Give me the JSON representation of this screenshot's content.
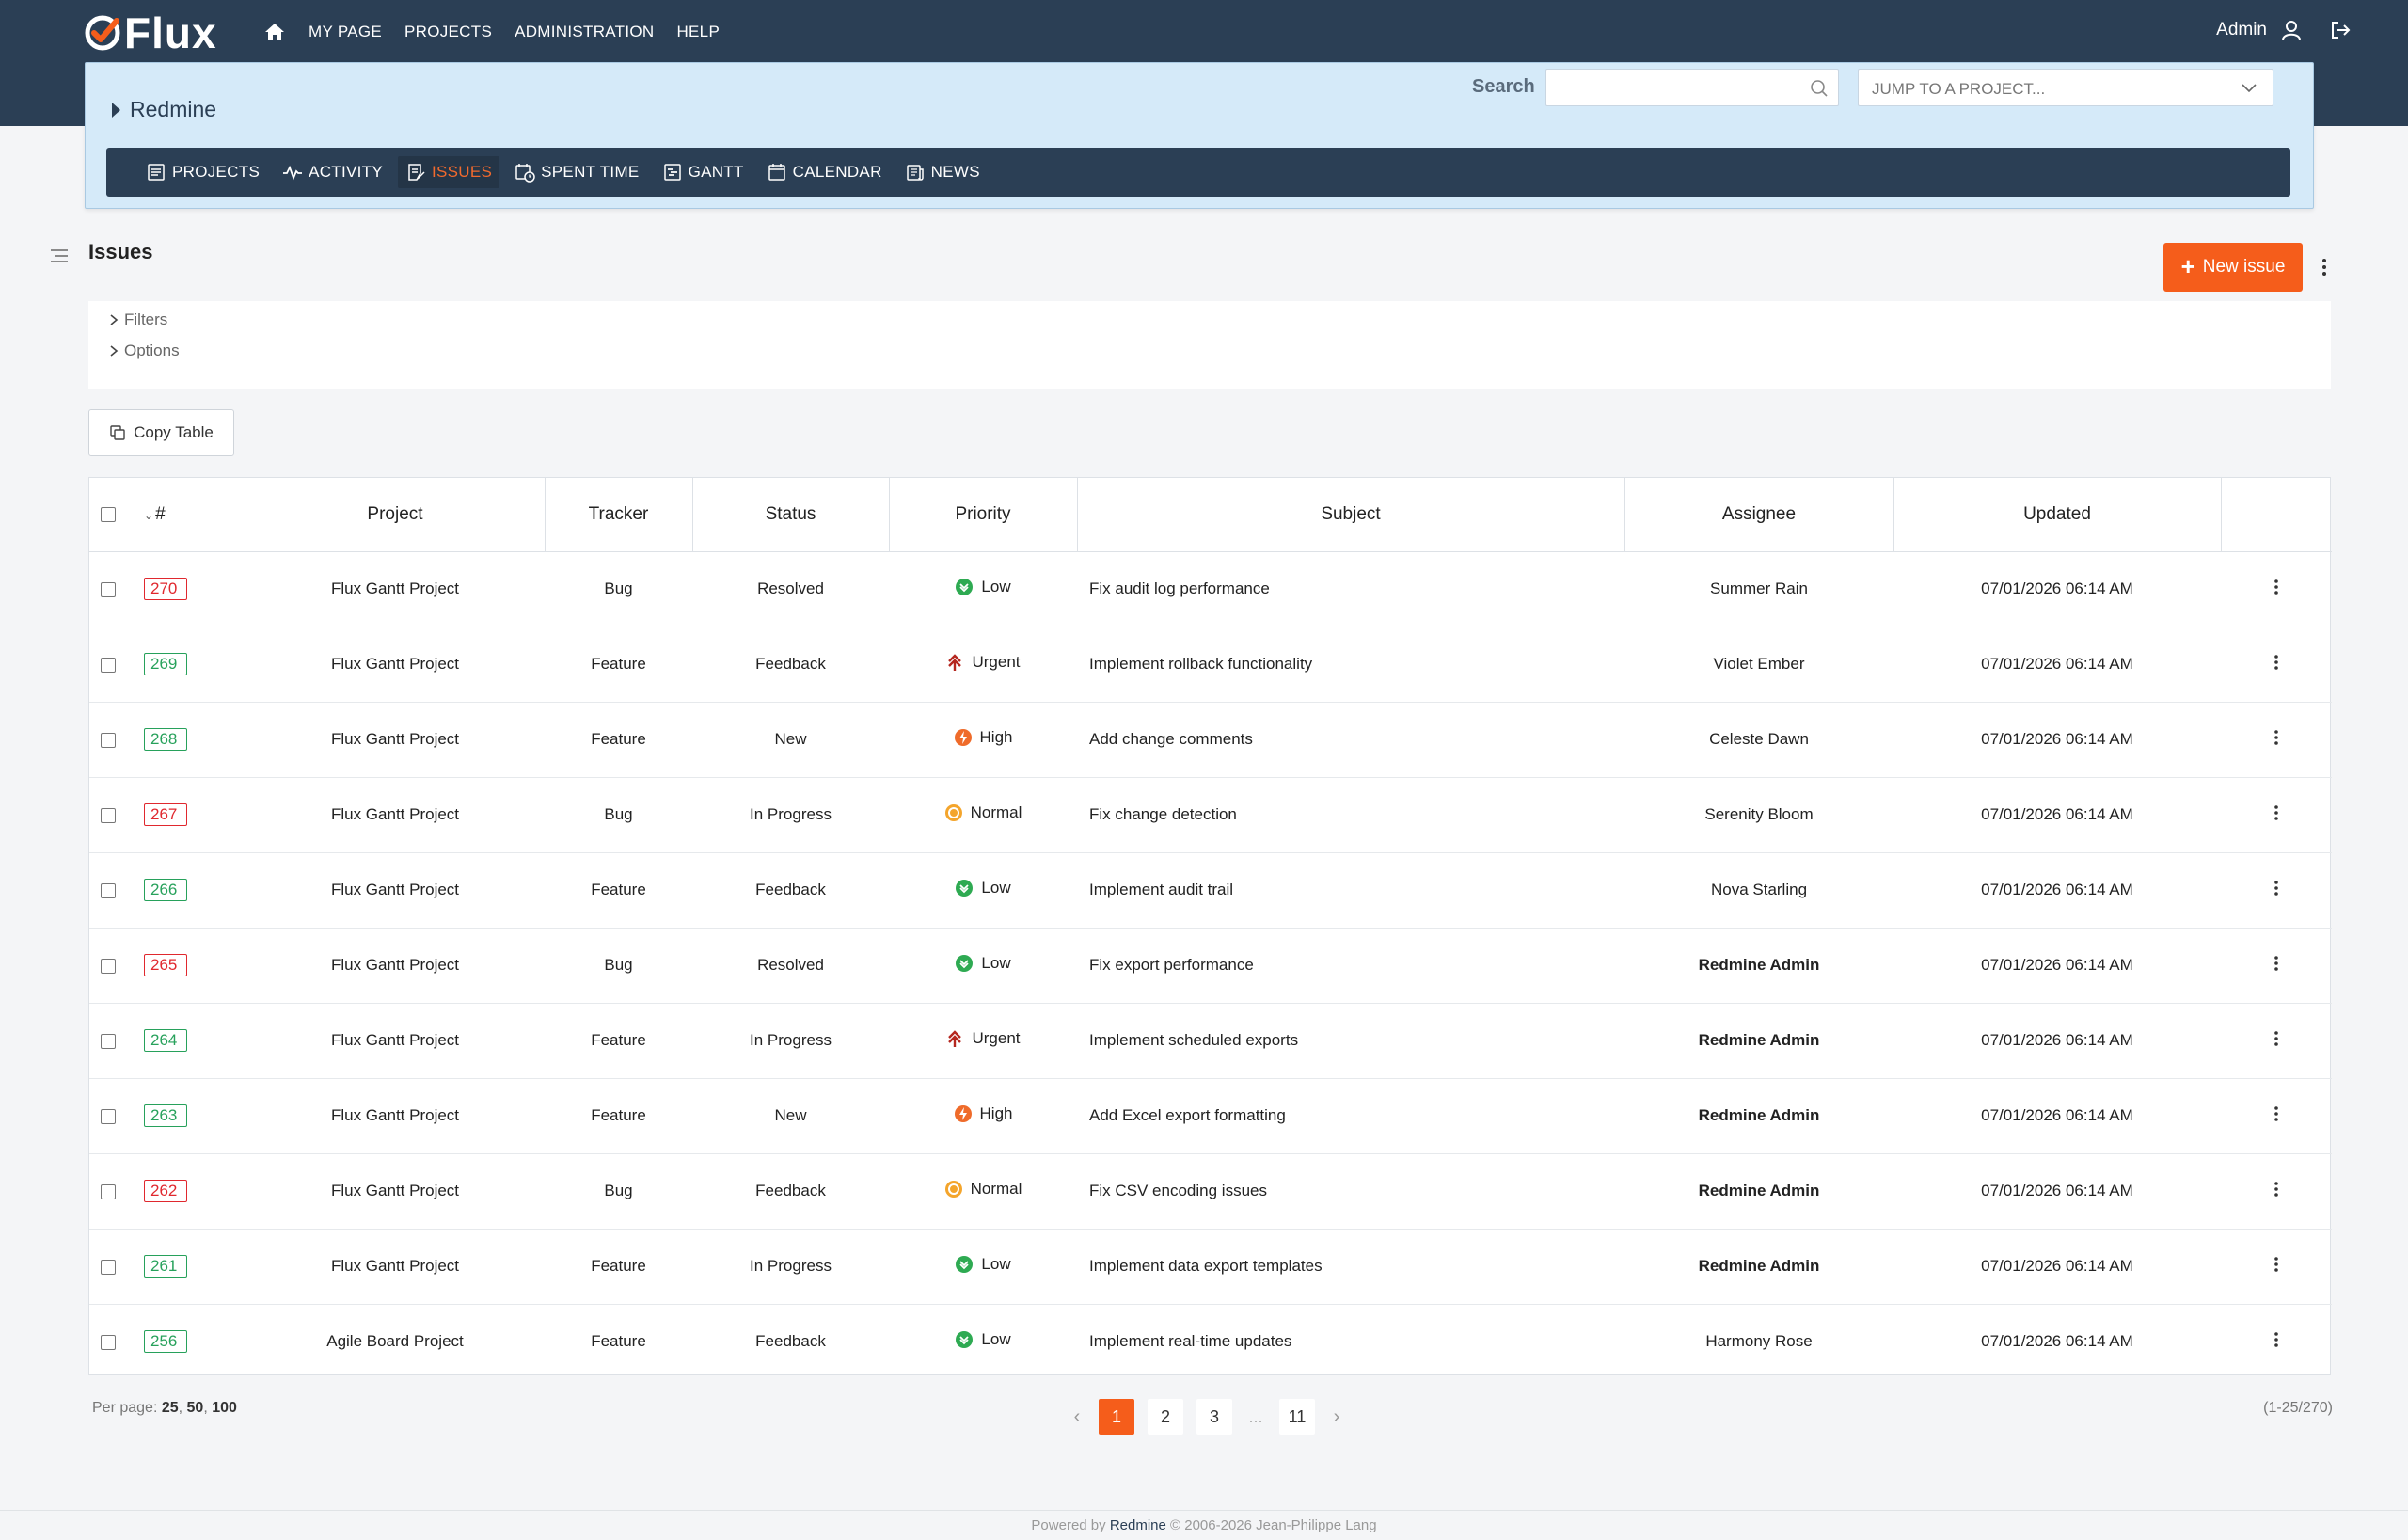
{
  "brand": {
    "name": "Flux"
  },
  "top_nav": {
    "items": [
      "MY PAGE",
      "PROJECTS",
      "ADMINISTRATION",
      "HELP"
    ]
  },
  "user": {
    "name": "Admin"
  },
  "project": {
    "name": "Redmine"
  },
  "search": {
    "label": "Search",
    "value": "",
    "jump_placeholder": "JUMP TO A PROJECT..."
  },
  "project_menu": {
    "items": [
      {
        "label": "PROJECTS",
        "icon": "projects-icon"
      },
      {
        "label": "ACTIVITY",
        "icon": "activity-icon"
      },
      {
        "label": "ISSUES",
        "icon": "issues-icon",
        "active": true
      },
      {
        "label": "SPENT TIME",
        "icon": "spent-time-icon"
      },
      {
        "label": "GANTT",
        "icon": "gantt-icon"
      },
      {
        "label": "CALENDAR",
        "icon": "calendar-icon"
      },
      {
        "label": "NEWS",
        "icon": "news-icon"
      }
    ]
  },
  "page": {
    "title": "Issues",
    "new_issue_label": "New issue"
  },
  "filters": {
    "filters_label": "Filters",
    "options_label": "Options"
  },
  "toolbar": {
    "copy_table_label": "Copy Table"
  },
  "table": {
    "columns": [
      "#",
      "Project",
      "Tracker",
      "Status",
      "Priority",
      "Subject",
      "Assignee",
      "Updated"
    ],
    "rows": [
      {
        "id": "270",
        "project": "Flux Gantt Project",
        "tracker": "Bug",
        "status": "Resolved",
        "priority": "Low",
        "subject": "Fix audit log performance",
        "assignee": "Summer Rain",
        "assignee_bold": false,
        "updated": "07/01/2026 06:14 AM"
      },
      {
        "id": "269",
        "project": "Flux Gantt Project",
        "tracker": "Feature",
        "status": "Feedback",
        "priority": "Urgent",
        "subject": "Implement rollback functionality",
        "assignee": "Violet Ember",
        "assignee_bold": false,
        "updated": "07/01/2026 06:14 AM"
      },
      {
        "id": "268",
        "project": "Flux Gantt Project",
        "tracker": "Feature",
        "status": "New",
        "priority": "High",
        "subject": "Add change comments",
        "assignee": "Celeste Dawn",
        "assignee_bold": false,
        "updated": "07/01/2026 06:14 AM"
      },
      {
        "id": "267",
        "project": "Flux Gantt Project",
        "tracker": "Bug",
        "status": "In Progress",
        "priority": "Normal",
        "subject": "Fix change detection",
        "assignee": "Serenity Bloom",
        "assignee_bold": false,
        "updated": "07/01/2026 06:14 AM"
      },
      {
        "id": "266",
        "project": "Flux Gantt Project",
        "tracker": "Feature",
        "status": "Feedback",
        "priority": "Low",
        "subject": "Implement audit trail",
        "assignee": "Nova Starling",
        "assignee_bold": false,
        "updated": "07/01/2026 06:14 AM"
      },
      {
        "id": "265",
        "project": "Flux Gantt Project",
        "tracker": "Bug",
        "status": "Resolved",
        "priority": "Low",
        "subject": "Fix export performance",
        "assignee": "Redmine Admin",
        "assignee_bold": true,
        "updated": "07/01/2026 06:14 AM"
      },
      {
        "id": "264",
        "project": "Flux Gantt Project",
        "tracker": "Feature",
        "status": "In Progress",
        "priority": "Urgent",
        "subject": "Implement scheduled exports",
        "assignee": "Redmine Admin",
        "assignee_bold": true,
        "updated": "07/01/2026 06:14 AM"
      },
      {
        "id": "263",
        "project": "Flux Gantt Project",
        "tracker": "Feature",
        "status": "New",
        "priority": "High",
        "subject": "Add Excel export formatting",
        "assignee": "Redmine Admin",
        "assignee_bold": true,
        "updated": "07/01/2026 06:14 AM"
      },
      {
        "id": "262",
        "project": "Flux Gantt Project",
        "tracker": "Bug",
        "status": "Feedback",
        "priority": "Normal",
        "subject": "Fix CSV encoding issues",
        "assignee": "Redmine Admin",
        "assignee_bold": true,
        "updated": "07/01/2026 06:14 AM"
      },
      {
        "id": "261",
        "project": "Flux Gantt Project",
        "tracker": "Feature",
        "status": "In Progress",
        "priority": "Low",
        "subject": "Implement data export templates",
        "assignee": "Redmine Admin",
        "assignee_bold": true,
        "updated": "07/01/2026 06:14 AM"
      },
      {
        "id": "256",
        "project": "Agile Board Project",
        "tracker": "Feature",
        "status": "Feedback",
        "priority": "Low",
        "subject": "Implement real-time updates",
        "assignee": "Harmony Rose",
        "assignee_bold": false,
        "updated": "07/01/2026 06:14 AM"
      }
    ]
  },
  "pagination": {
    "per_page_label": "Per page:",
    "per_page_options": [
      "25",
      "50",
      "100"
    ],
    "pages": [
      "1",
      "2",
      "3",
      "...",
      "11"
    ],
    "current": "1",
    "range": "(1-25/270)"
  },
  "footer": {
    "prefix": "Powered by",
    "link": "Redmine",
    "suffix": "© 2006-2026 Jean-Philippe Lang"
  },
  "colors": {
    "accent": "#f55d1b",
    "nav": "#2b3f55",
    "bug": "#e0282e",
    "feature": "#27a15b"
  }
}
